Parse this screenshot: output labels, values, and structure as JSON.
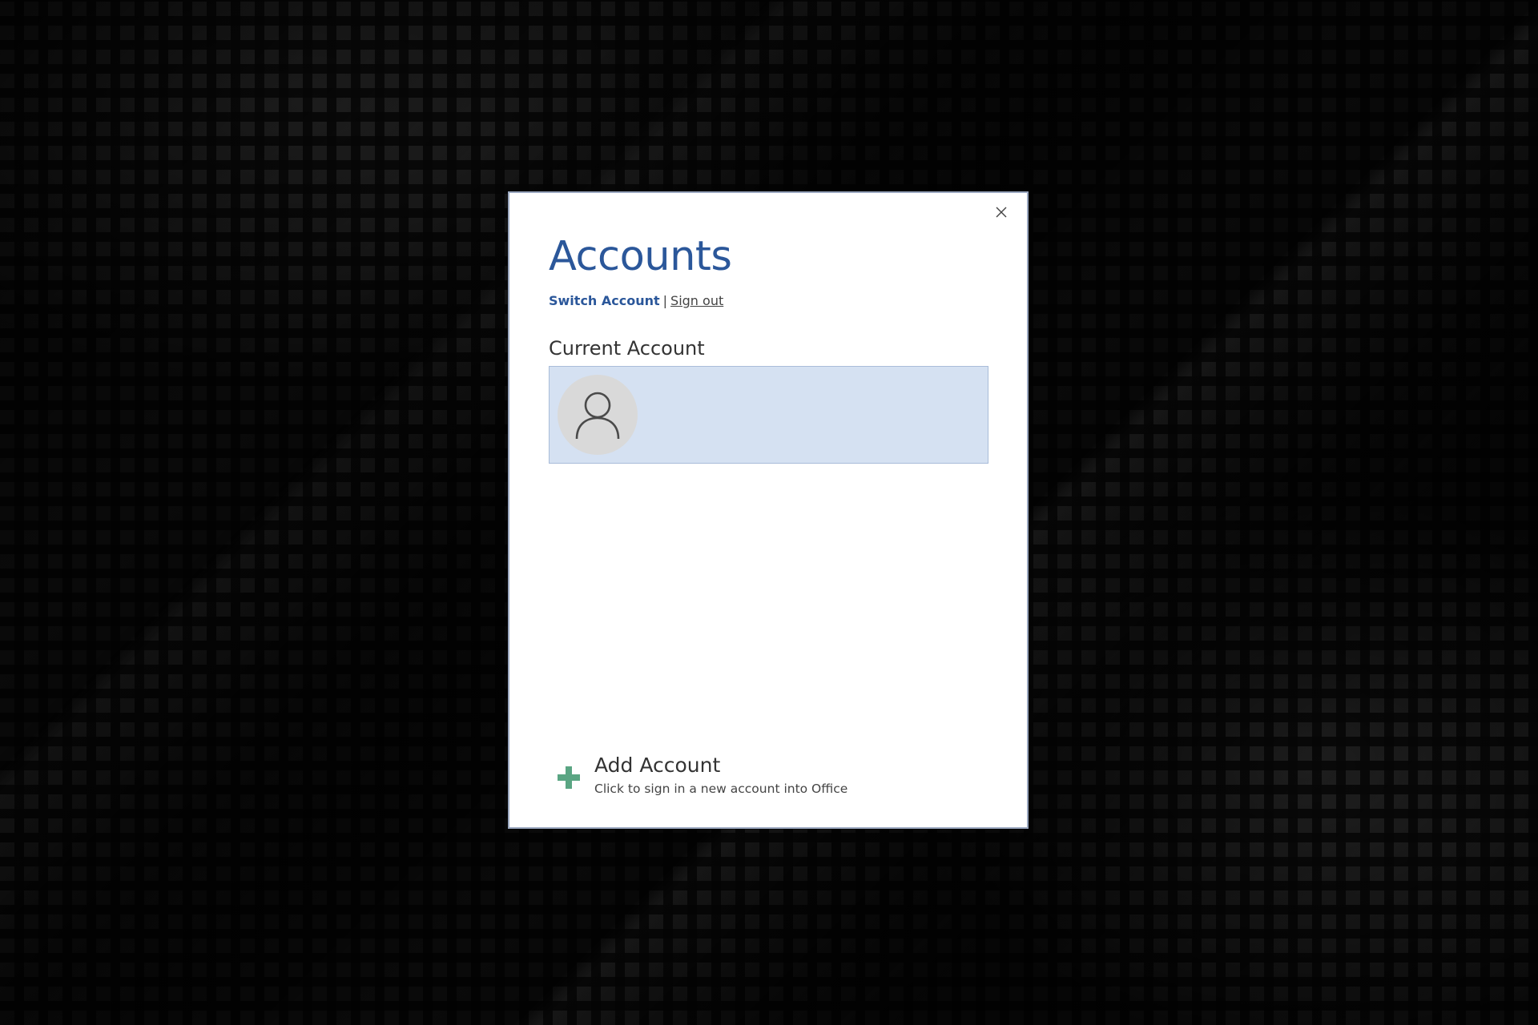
{
  "dialog": {
    "title": "Accounts",
    "links": {
      "switch_account": "Switch Account",
      "separator": "|",
      "sign_out": "Sign out"
    },
    "current_account_label": "Current Account",
    "add_account": {
      "title": "Add Account",
      "subtitle": "Click to sign in a new account into Office"
    }
  },
  "colors": {
    "accent": "#2b579a",
    "card_background": "#d5e1f2",
    "plus_icon": "#5aa583",
    "avatar_background": "#d9d9d9"
  },
  "icons": {
    "close": "close-icon",
    "avatar": "person-icon",
    "add": "plus-icon"
  }
}
